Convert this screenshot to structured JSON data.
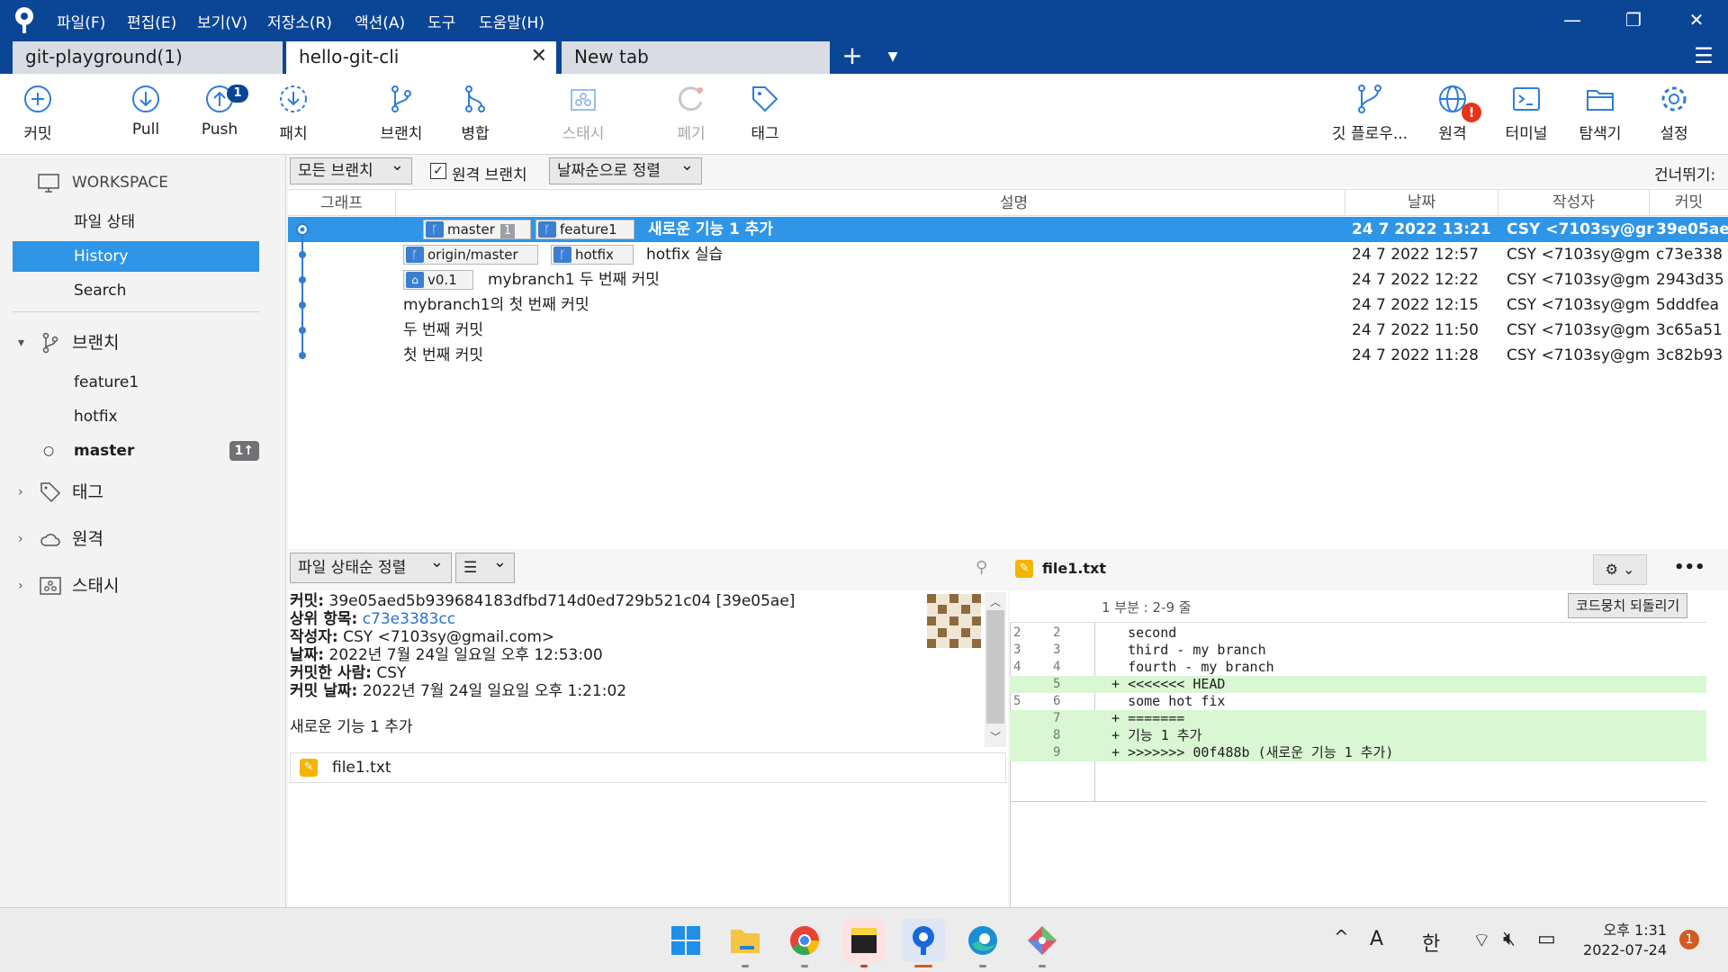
{
  "menu": [
    "파일(F)",
    "편집(E)",
    "보기(V)",
    "저장소(R)",
    "액션(A)",
    "도구",
    "도움말(H)"
  ],
  "window_controls": {
    "minimize": "—",
    "restore": "❐",
    "close": "✕"
  },
  "tabs": [
    {
      "label": "git-playground(1)",
      "active": false
    },
    {
      "label": "hello-git-cli",
      "active": true,
      "close": "✕"
    },
    {
      "label": "New tab",
      "active": false
    }
  ],
  "tab_add": "+",
  "toolbar": {
    "commit": "커밋",
    "pull": "Pull",
    "push": "Push",
    "push_badge": "1",
    "patch": "패치",
    "branch": "브랜치",
    "merge": "병합",
    "stash": "스태시",
    "discard": "폐기",
    "tag": "태그",
    "git_flow": "깃 플로우...",
    "remote": "원격",
    "remote_badge": "!",
    "terminal": "터미널",
    "explorer": "탐색기",
    "settings": "설정"
  },
  "sidebar": {
    "workspace": "WORKSPACE",
    "file_status": "파일 상태",
    "history": "History",
    "search": "Search",
    "branches_header": "브랜치",
    "branches": [
      "feature1",
      "hotfix",
      "master"
    ],
    "master_badge": "1↑",
    "tags_header": "태그",
    "remotes_header": "원격",
    "stash_header": "스태시"
  },
  "filter": {
    "branches_dd": "모든 브랜치",
    "remote_branches": "원격 브랜치",
    "remote_checked": "✓",
    "sort_dd": "날짜순으로 정렬",
    "skip_label": "건너뛰기:"
  },
  "columns": {
    "graph": "그래프",
    "description": "설명",
    "date": "날짜",
    "author": "작성자",
    "commit": "커밋"
  },
  "commits": [
    {
      "desc": "새로운 기능 1 추가",
      "date": "24 7 2022 13:21",
      "author": "CSY <7103sy@gr",
      "hash": "39e05ae",
      "refs": [
        {
          "name": "master",
          "count": "1"
        },
        {
          "name": "feature1"
        }
      ]
    },
    {
      "desc": "hotfix 실습",
      "date": "24 7 2022 12:57",
      "author": "CSY <7103sy@gm",
      "hash": "c73e338",
      "refs": [
        {
          "name": "origin/master"
        },
        {
          "name": "hotfix"
        }
      ]
    },
    {
      "desc": "mybranch1 두 번째 커밋",
      "date": "24 7 2022 12:22",
      "author": "CSY <7103sy@gm",
      "hash": "2943d35",
      "refs": [
        {
          "name": "v0.1"
        }
      ]
    },
    {
      "desc": "mybranch1의 첫 번째 커밋",
      "date": "24 7 2022 12:15",
      "author": "CSY <7103sy@gm",
      "hash": "5dddfea",
      "refs": []
    },
    {
      "desc": "두 번째 커밋",
      "date": "24 7 2022 11:50",
      "author": "CSY <7103sy@gm",
      "hash": "3c65a51",
      "refs": []
    },
    {
      "desc": "첫 번째 커밋",
      "date": "24 7 2022 11:28",
      "author": "CSY <7103sy@gm",
      "hash": "3c82b93",
      "refs": []
    }
  ],
  "detail": {
    "sort_dd": "파일 상태순 정렬",
    "view_dd": "☰",
    "commit_label": "커밋:",
    "commit_value": "39e05aed5b939684183dfbd714d0ed729b521c04 [39e05ae]",
    "parent_label": "상위 항목:",
    "parent_value": "c73e3383cc",
    "author_label": "작성자:",
    "author_value": "CSY <7103sy@gmail.com>",
    "date_label": "날짜:",
    "date_value": "2022년 7월 24일 일요일 오후 12:53:00",
    "committer_label": "커밋한 사람:",
    "committer_value": "CSY",
    "commit_date_label": "커밋 날짜:",
    "commit_date_value": "2022년 7월 24일 일요일 오후 1:21:02",
    "message": "새로운 기능 1 추가",
    "files": [
      "file1.txt"
    ]
  },
  "diff": {
    "filename": "file1.txt",
    "more": "•••",
    "hunk_label": "1 부분 : 2-9 줄",
    "revert_button": "코드뭉치 되돌리기",
    "lines": [
      {
        "old": "2",
        "new": "2",
        "text": "   second",
        "type": "ctx"
      },
      {
        "old": "3",
        "new": "3",
        "text": "   third - my branch",
        "type": "ctx"
      },
      {
        "old": "4",
        "new": "4",
        "text": "   fourth - my branch",
        "type": "ctx"
      },
      {
        "old": "",
        "new": "5",
        "text": " + <<<<<<< HEAD",
        "type": "add"
      },
      {
        "old": "5",
        "new": "6",
        "text": "   some hot fix",
        "type": "ctx"
      },
      {
        "old": "",
        "new": "7",
        "text": " + =======",
        "type": "add"
      },
      {
        "old": "",
        "new": "8",
        "text": " + 기능 1 추가",
        "type": "add"
      },
      {
        "old": "",
        "new": "9",
        "text": " + >>>>>>> 00f488b (새로운 기능 1 추가)",
        "type": "add"
      }
    ]
  },
  "taskbar": {
    "ime_a": "A",
    "ime_han": "한",
    "time": "오후 1:31",
    "date": "2022-07-24",
    "notify_count": "1",
    "tray_up": "^"
  }
}
